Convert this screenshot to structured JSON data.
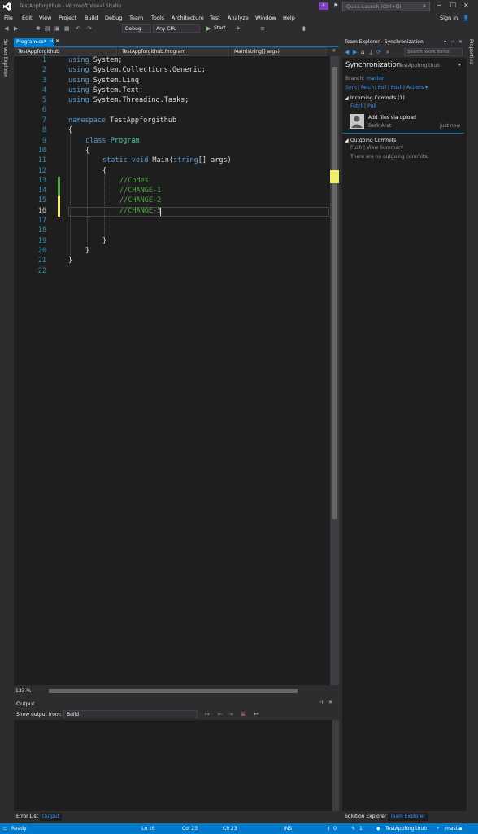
{
  "window": {
    "title": "TestAppforgithub - Microsoft Visual Studio",
    "notification_count": "4",
    "quick_launch_placeholder": "Quick Launch (Ctrl+Q)",
    "sign_in": "Sign in"
  },
  "menu": [
    "File",
    "Edit",
    "View",
    "Project",
    "Build",
    "Debug",
    "Team",
    "Tools",
    "Architecture",
    "Test",
    "Analyze",
    "Window",
    "Help"
  ],
  "toolbar": {
    "configuration": "Debug",
    "platform": "Any CPU",
    "start_label": "Start"
  },
  "side": {
    "left_label": "Server Explorer",
    "right_label": "Properties"
  },
  "editor": {
    "tab_label": "Program.cs*",
    "nav_project": "TestAppforgithub",
    "nav_class": "TestAppforgithub.Program",
    "nav_member": "Main(string[] args)",
    "zoom": "133 %",
    "line_numbers": [
      "1",
      "2",
      "3",
      "4",
      "5",
      "6",
      "7",
      "8",
      "9",
      "10",
      "11",
      "12",
      "13",
      "14",
      "15",
      "16",
      "17",
      "18",
      "19",
      "20",
      "21",
      "22"
    ],
    "lines": {
      "l1_kw": "using",
      "l1_rest": " System;",
      "l2_kw": "using",
      "l2_rest": " System.Collections.Generic;",
      "l3_kw": "using",
      "l3_rest": " System.Linq;",
      "l4_kw": "using",
      "l4_rest": " System.Text;",
      "l5_kw": "using",
      "l5_rest": " System.Threading.Tasks;",
      "l7_kw": "namespace",
      "l7_rest": " TestAppforgithub",
      "l8": "{",
      "l9_kw": "class",
      "l9_cls": " Program",
      "l10": "{",
      "l11_kw1": "static",
      "l11_kw2": " void",
      "l11_rest1": " Main(",
      "l11_kw3": "string",
      "l11_rest2": "[] args)",
      "l12": "{",
      "l13": "//Codes",
      "l14": "//CHANGE-1",
      "l15": "//CHANGE-2",
      "l16": "//CHANGE-3",
      "l19": "}",
      "l20": "}",
      "l21": "}"
    }
  },
  "output": {
    "title": "Output",
    "show_from_label": "Show output from:",
    "source": "Build",
    "tabs": [
      "Error List",
      "Output"
    ]
  },
  "team_explorer": {
    "title": "Team Explorer - Synchronization",
    "search_placeholder": "Search Work Items",
    "heading": "Synchronization",
    "repo": "TestAppforgithub",
    "branch_label": "Branch:",
    "branch": "master",
    "actions": [
      "Sync",
      "Fetch",
      "Pull",
      "Push",
      "Actions"
    ],
    "incoming_title": "Incoming Commits (1)",
    "incoming_links": [
      "Fetch",
      "Pull"
    ],
    "commit_message": "Add files via upload",
    "commit_author": "Berk Arat",
    "commit_time": "just now",
    "outgoing_title": "Outgoing Commits",
    "outgoing_links": [
      "Push",
      "View Summary"
    ],
    "outgoing_empty": "There are no outgoing commits.",
    "bottom_tabs": [
      "Solution Explorer",
      "Team Explorer"
    ]
  },
  "status": {
    "state": "Ready",
    "line": "Ln 16",
    "col": "Col 23",
    "ch": "Ch 23",
    "mode": "INS",
    "up_count": "0",
    "pencil_count": "1",
    "repo": "TestAppforgithub",
    "branch": "master"
  },
  "colors": {
    "accent": "#007acc",
    "keyword": "#569cd6",
    "type": "#4ec9b0",
    "comment": "#57a64a",
    "line_number": "#2b91af",
    "saved_change": "#57a64a",
    "unsaved_change": "#efef6a"
  }
}
